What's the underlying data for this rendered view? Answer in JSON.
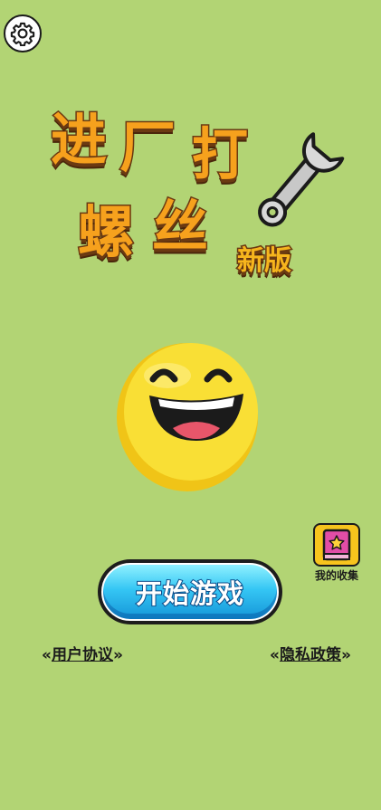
{
  "app": {
    "title_line1": [
      "进",
      "厂",
      "打"
    ],
    "title_line2": [
      "螺",
      "丝"
    ],
    "title_badge": "新版"
  },
  "icons": {
    "settings": "gear-icon",
    "logo_wrench": "wrench-icon",
    "mascot": "laughing-smiley-icon",
    "collection": "book-star-icon"
  },
  "collection": {
    "label": "我的收集"
  },
  "start_button": {
    "label": "开始游戏"
  },
  "links": {
    "user_agreement": {
      "open": "«",
      "text": "用户协议",
      "close": "»"
    },
    "privacy_policy": {
      "open": "«",
      "text": "隐私政策",
      "close": "»"
    }
  },
  "colors": {
    "background": "#b2d474",
    "title_fill": "#f6a11d",
    "title_outline": "#6b3a12",
    "button_blue": "#35c6f4",
    "smiley_yellow": "#f9df35"
  }
}
